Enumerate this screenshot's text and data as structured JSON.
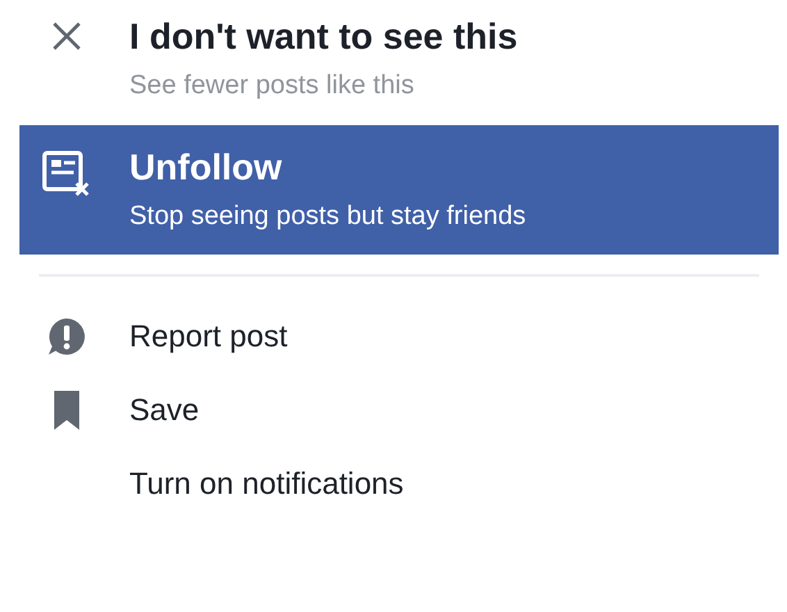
{
  "menu": {
    "top_items": [
      {
        "title": "I don't want to see this",
        "subtitle": "See fewer posts like this",
        "selected": false
      },
      {
        "title": "Unfollow",
        "subtitle": "Stop seeing posts but stay friends",
        "selected": true
      }
    ],
    "bottom_items": [
      {
        "label": "Report post",
        "selected": false
      },
      {
        "label": "Save",
        "selected": false
      },
      {
        "label": "Turn on notifications",
        "selected": false
      }
    ]
  }
}
